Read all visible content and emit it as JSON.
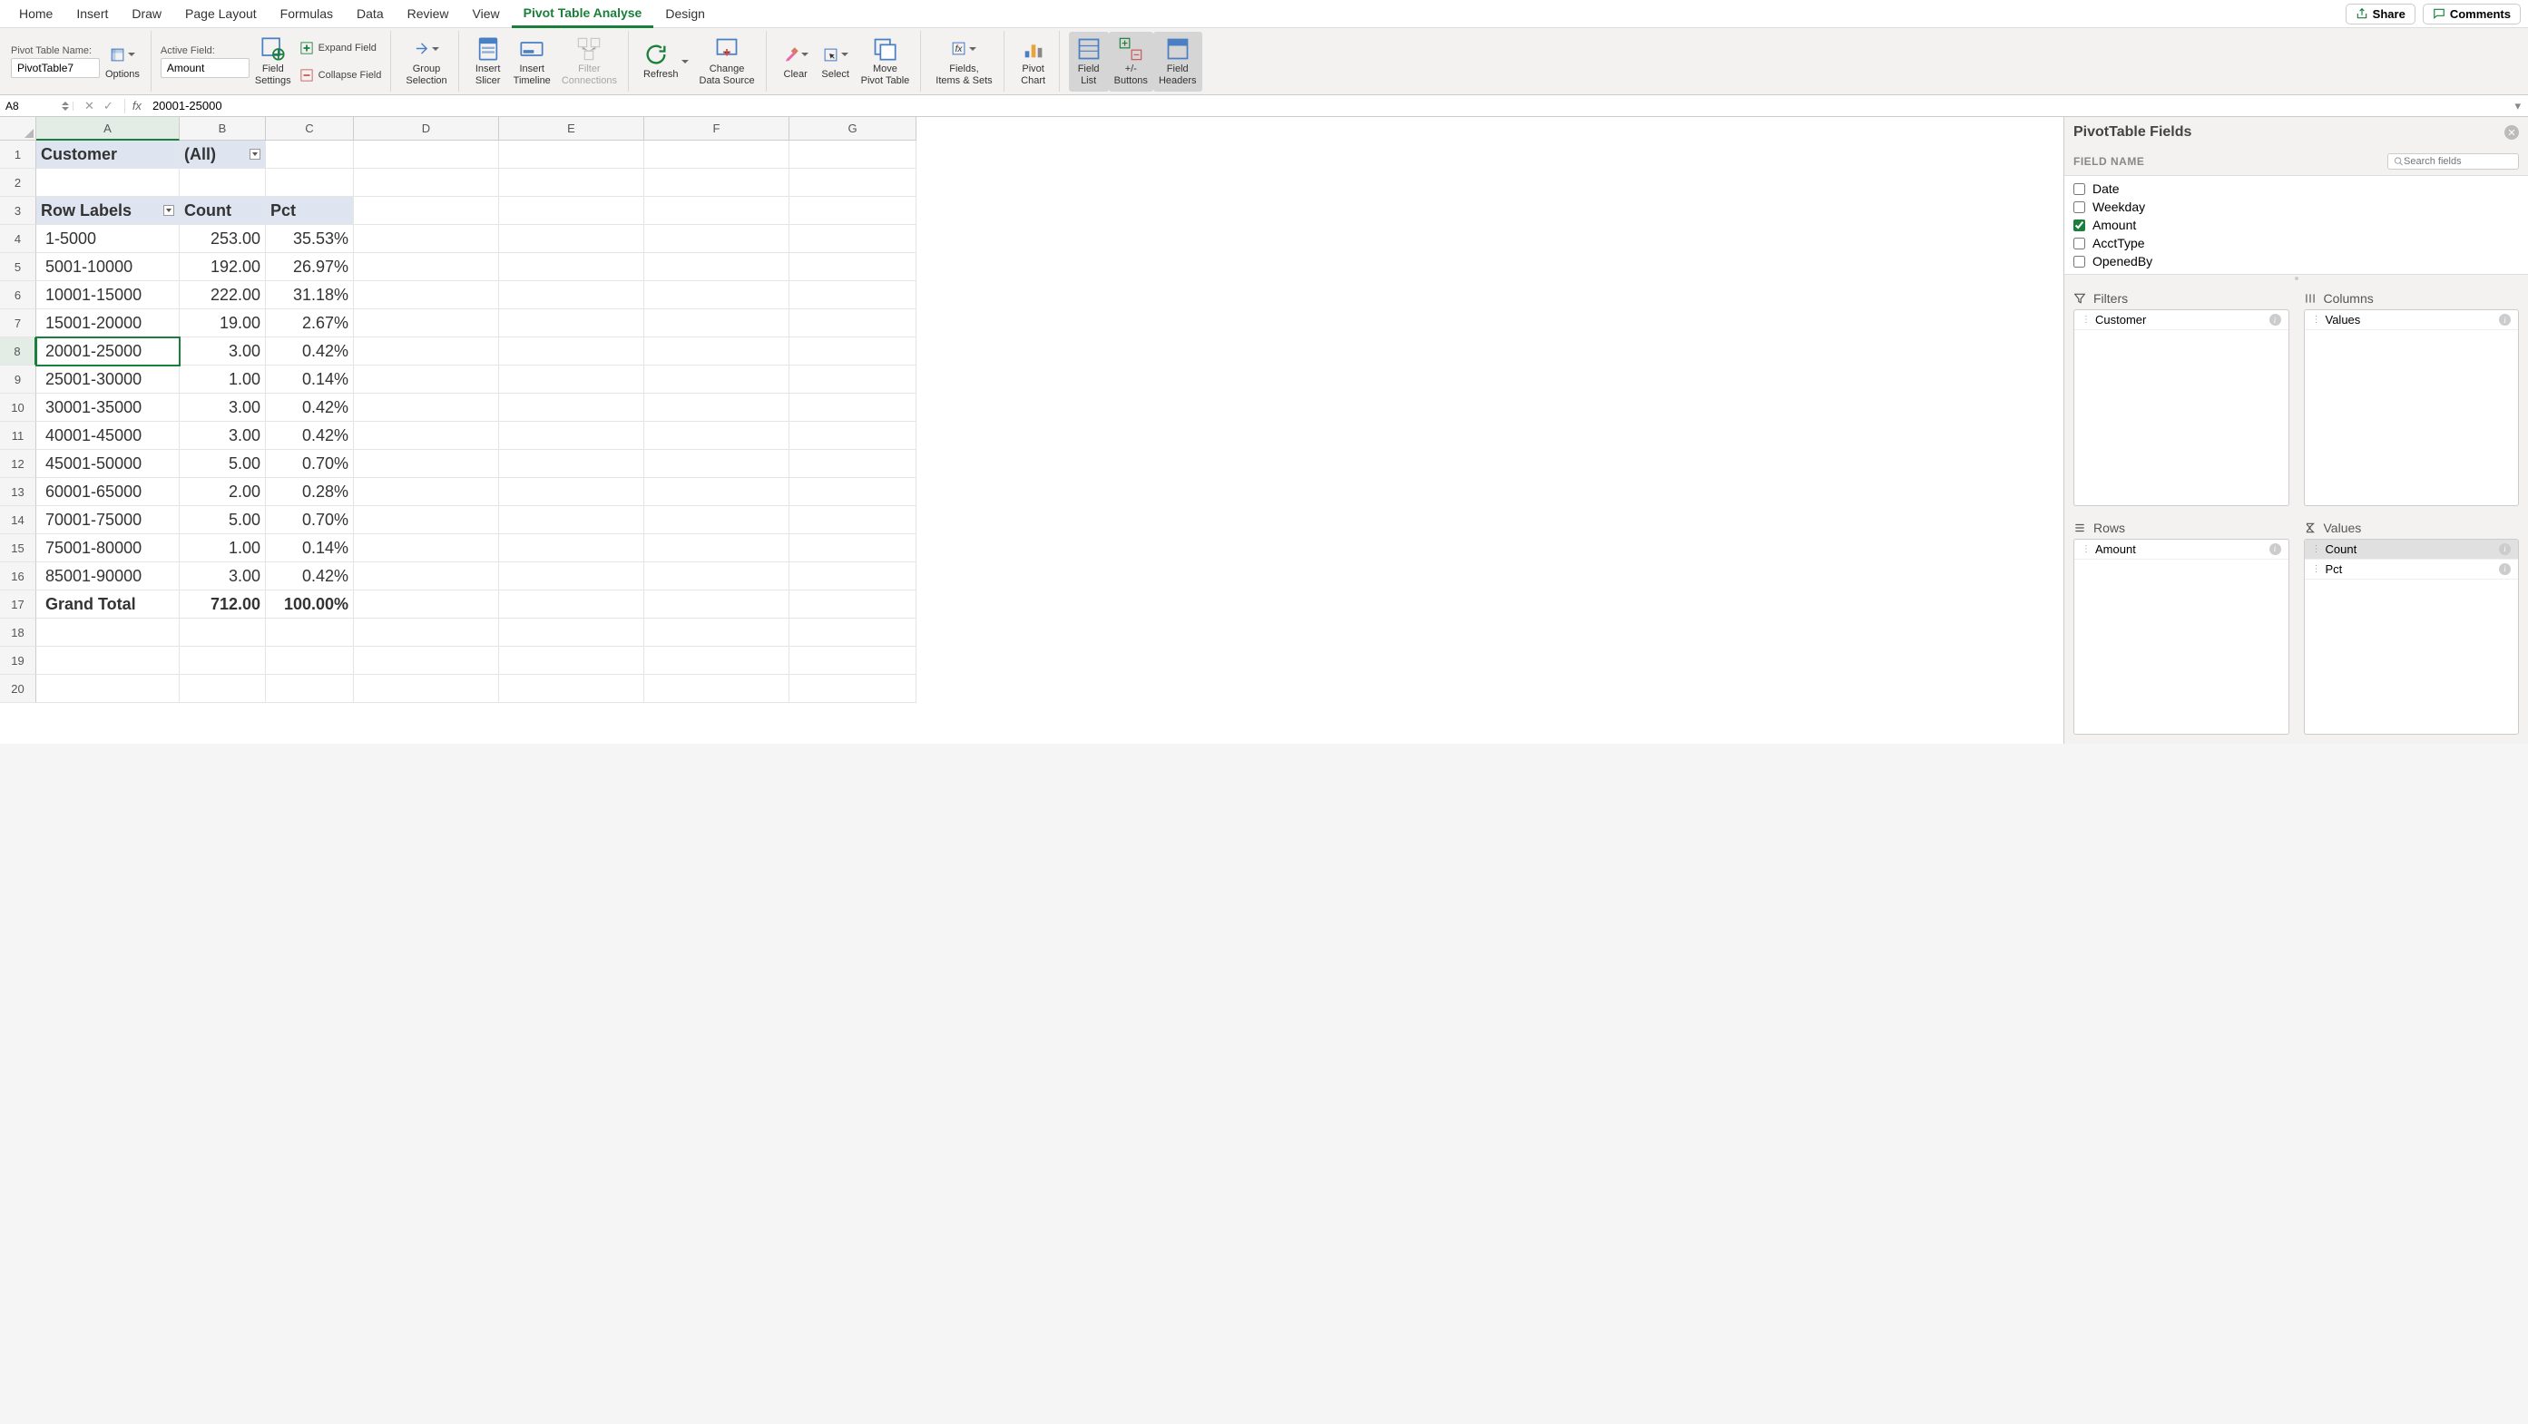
{
  "tabs": [
    "Home",
    "Insert",
    "Draw",
    "Page Layout",
    "Formulas",
    "Data",
    "Review",
    "View",
    "Pivot Table Analyse",
    "Design"
  ],
  "activeTab": "Pivot Table Analyse",
  "share": "Share",
  "comments": "Comments",
  "ribbon": {
    "ptNameLabel": "Pivot Table Name:",
    "ptName": "PivotTable7",
    "options": "Options",
    "activeFieldLabel": "Active Field:",
    "activeField": "Amount",
    "fieldSettings": "Field\nSettings",
    "expandField": "Expand Field",
    "collapseField": "Collapse Field",
    "groupSelection": "Group\nSelection",
    "insertSlicer": "Insert\nSlicer",
    "insertTimeline": "Insert\nTimeline",
    "filterConnections": "Filter\nConnections",
    "refresh": "Refresh",
    "changeDataSource": "Change\nData Source",
    "clear": "Clear",
    "select": "Select",
    "movePivotTable": "Move\nPivot Table",
    "fieldsItemsSets": "Fields,\nItems & Sets",
    "pivotChart": "Pivot\nChart",
    "fieldList": "Field\nList",
    "plusMinusButtons": "+/-\nButtons",
    "fieldHeaders": "Field\nHeaders"
  },
  "nameBox": "A8",
  "formula": "20001-25000",
  "cols": [
    "A",
    "B",
    "C",
    "D",
    "E",
    "F",
    "G"
  ],
  "rows": [
    "1",
    "2",
    "3",
    "4",
    "5",
    "6",
    "7",
    "8",
    "9",
    "10",
    "11",
    "12",
    "13",
    "14",
    "15",
    "16",
    "17",
    "18",
    "19",
    "20"
  ],
  "sheet": {
    "customerLabel": "Customer",
    "customerFilter": "(All)",
    "rowLabels": "Row Labels",
    "countHead": "Count",
    "pctHead": "Pct",
    "data": [
      {
        "label": "1-5000",
        "count": "253.00",
        "pct": "35.53%"
      },
      {
        "label": "5001-10000",
        "count": "192.00",
        "pct": "26.97%"
      },
      {
        "label": "10001-15000",
        "count": "222.00",
        "pct": "31.18%"
      },
      {
        "label": "15001-20000",
        "count": "19.00",
        "pct": "2.67%"
      },
      {
        "label": "20001-25000",
        "count": "3.00",
        "pct": "0.42%"
      },
      {
        "label": "25001-30000",
        "count": "1.00",
        "pct": "0.14%"
      },
      {
        "label": "30001-35000",
        "count": "3.00",
        "pct": "0.42%"
      },
      {
        "label": "40001-45000",
        "count": "3.00",
        "pct": "0.42%"
      },
      {
        "label": "45001-50000",
        "count": "5.00",
        "pct": "0.70%"
      },
      {
        "label": "60001-65000",
        "count": "2.00",
        "pct": "0.28%"
      },
      {
        "label": "70001-75000",
        "count": "5.00",
        "pct": "0.70%"
      },
      {
        "label": "75001-80000",
        "count": "1.00",
        "pct": "0.14%"
      },
      {
        "label": "85001-90000",
        "count": "3.00",
        "pct": "0.42%"
      }
    ],
    "grandTotal": "Grand Total",
    "grandCount": "712.00",
    "grandPct": "100.00%"
  },
  "pane": {
    "title": "PivotTable Fields",
    "fieldNameLabel": "FIELD NAME",
    "searchPlaceholder": "Search fields",
    "fields": [
      {
        "name": "Date",
        "checked": false
      },
      {
        "name": "Weekday",
        "checked": false
      },
      {
        "name": "Amount",
        "checked": true
      },
      {
        "name": "AcctType",
        "checked": false
      },
      {
        "name": "OpenedBy",
        "checked": false
      }
    ],
    "filters": "Filters",
    "columns": "Columns",
    "rowsLabel": "Rows",
    "values": "Values",
    "filterItems": [
      "Customer"
    ],
    "columnItems": [
      "Values"
    ],
    "rowItems": [
      "Amount"
    ],
    "valueItems": [
      "Count",
      "Pct"
    ]
  }
}
